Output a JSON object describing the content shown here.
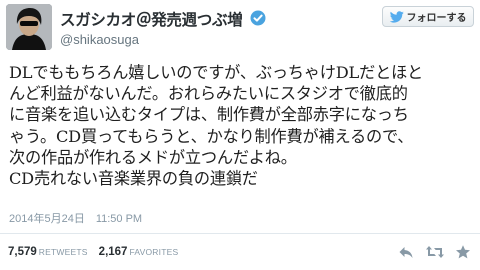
{
  "user": {
    "display_name": "スガシカオ＠発売週つぶ増",
    "handle": "@shikaosuga",
    "verified_icon": "verified-badge-icon"
  },
  "follow_button": {
    "label": "フォローする",
    "icon": "bird-icon"
  },
  "tweet": {
    "lines": [
      "DLでももちろん嬉しいのですが、ぶっちゃけDLだとほと",
      "んど利益がないんだ。おれらみたいにスタジオで徹底的",
      "に音楽を追い込むタイプは、制作費が全部赤字になっち",
      "ゃう。CD買ってもらうと、かなり制作費が補えるので、",
      "次の作品が作れるメドが立つんだよね。",
      "CD売れない音楽業界の負の連鎖だ"
    ],
    "timestamp": "2014年5月24日　11:50 PM"
  },
  "stats": {
    "retweets_count": "7,579",
    "retweets_label": "RETWEETS",
    "favorites_count": "2,167",
    "favorites_label": "FAVORITES"
  },
  "actions": {
    "reply_icon": "reply-icon",
    "retweet_icon": "retweet-icon",
    "favorite_icon": "star-icon"
  },
  "colors": {
    "verified_blue": "#4aa3df",
    "twitter_blue": "#55acee",
    "muted_text": "#8899a6"
  }
}
